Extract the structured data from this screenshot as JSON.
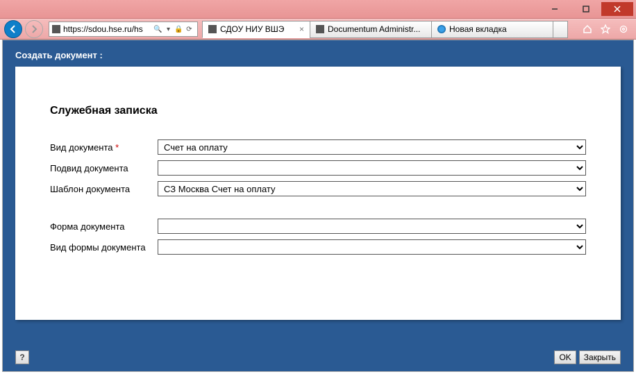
{
  "window": {
    "url": "https://sdou.hse.ru/hs"
  },
  "tabs": [
    {
      "label": "СДОУ НИУ ВШЭ",
      "active": true,
      "icon": "doc"
    },
    {
      "label": "Documentum Administr...",
      "active": false,
      "icon": "doc"
    },
    {
      "label": "Новая вкладка",
      "active": false,
      "icon": "ie"
    }
  ],
  "page": {
    "header": "Создать документ :",
    "title": "Служебная записка",
    "fields": {
      "doc_type": {
        "label": "Вид документа",
        "required": true,
        "value": "Счет на оплату"
      },
      "doc_subtype": {
        "label": "Подвид документа",
        "required": false,
        "value": ""
      },
      "doc_template": {
        "label": "Шаблон документа",
        "required": false,
        "value": "СЗ Москва Счет на оплату"
      },
      "doc_form": {
        "label": "Форма документа",
        "required": false,
        "value": ""
      },
      "doc_form_type": {
        "label": "Вид формы документа",
        "required": false,
        "value": ""
      }
    },
    "buttons": {
      "help": "?",
      "ok": "OK",
      "close": "Закрыть"
    }
  }
}
